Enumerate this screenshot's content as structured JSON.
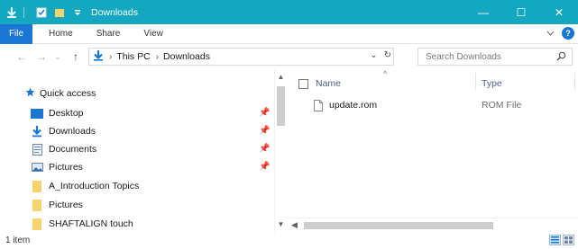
{
  "window": {
    "title": "Downloads",
    "controls": {
      "minimize": "—",
      "maximize": "☐",
      "close": "✕"
    }
  },
  "ribbon": {
    "file_tab": "File",
    "tabs": [
      "Home",
      "Share",
      "View"
    ]
  },
  "address": {
    "crumbs": [
      "This PC",
      "Downloads"
    ]
  },
  "search": {
    "placeholder": "Search Downloads"
  },
  "nav": {
    "quick_access": "Quick access",
    "items": [
      {
        "label": "Desktop",
        "icon": "desktop-icon",
        "pinned": true
      },
      {
        "label": "Downloads",
        "icon": "download-arrow-icon",
        "pinned": true
      },
      {
        "label": "Documents",
        "icon": "document-icon",
        "pinned": true
      },
      {
        "label": "Pictures",
        "icon": "pictures-icon",
        "pinned": true
      },
      {
        "label": "A_Introduction Topics",
        "icon": "folder-icon",
        "pinned": false
      },
      {
        "label": "Pictures",
        "icon": "folder-icon",
        "pinned": false
      },
      {
        "label": "SHAFTALIGN touch",
        "icon": "folder-icon",
        "pinned": false
      }
    ]
  },
  "columns": {
    "name": "Name",
    "type": "Type"
  },
  "files": [
    {
      "name": "update.rom",
      "type": "ROM File",
      "icon": "file-icon"
    }
  ],
  "status": {
    "count": "1 item"
  },
  "colors": {
    "titlebar": "#14a8c0",
    "accent": "#1976d2"
  }
}
